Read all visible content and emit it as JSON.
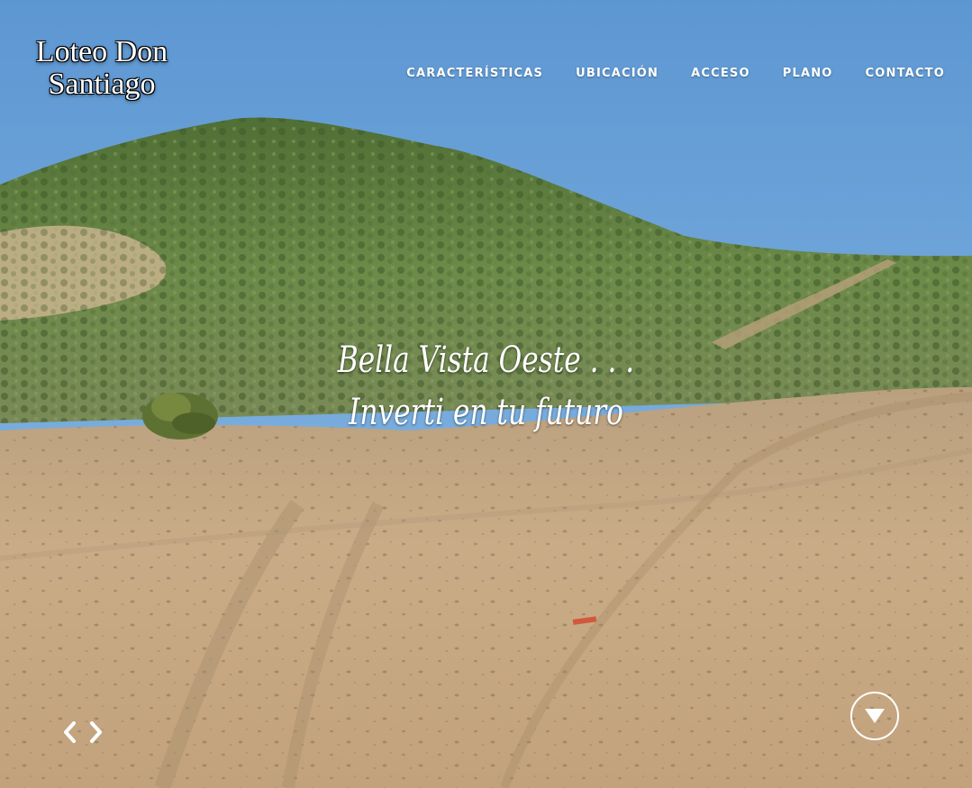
{
  "brand": {
    "line1": "Loteo Don",
    "line2": "Santiago"
  },
  "nav": {
    "items": [
      {
        "label": "CARACTERÍSTICAS"
      },
      {
        "label": "UBICACIÓN"
      },
      {
        "label": "ACCESO"
      },
      {
        "label": "PLANO"
      },
      {
        "label": "CONTACTO"
      }
    ]
  },
  "hero": {
    "line1": "Bella Vista Oeste . . .",
    "line2": "Inverti en tu futuro"
  },
  "slider": {
    "prev_icon": "chevron-left-icon",
    "next_icon": "chevron-right-icon"
  },
  "scroll": {
    "icon": "triangle-down-circle-icon"
  },
  "colors": {
    "sky": "#6ba3d8",
    "hill": "#5d7a3f",
    "ground": "#c6a883",
    "text": "#ffffff"
  }
}
